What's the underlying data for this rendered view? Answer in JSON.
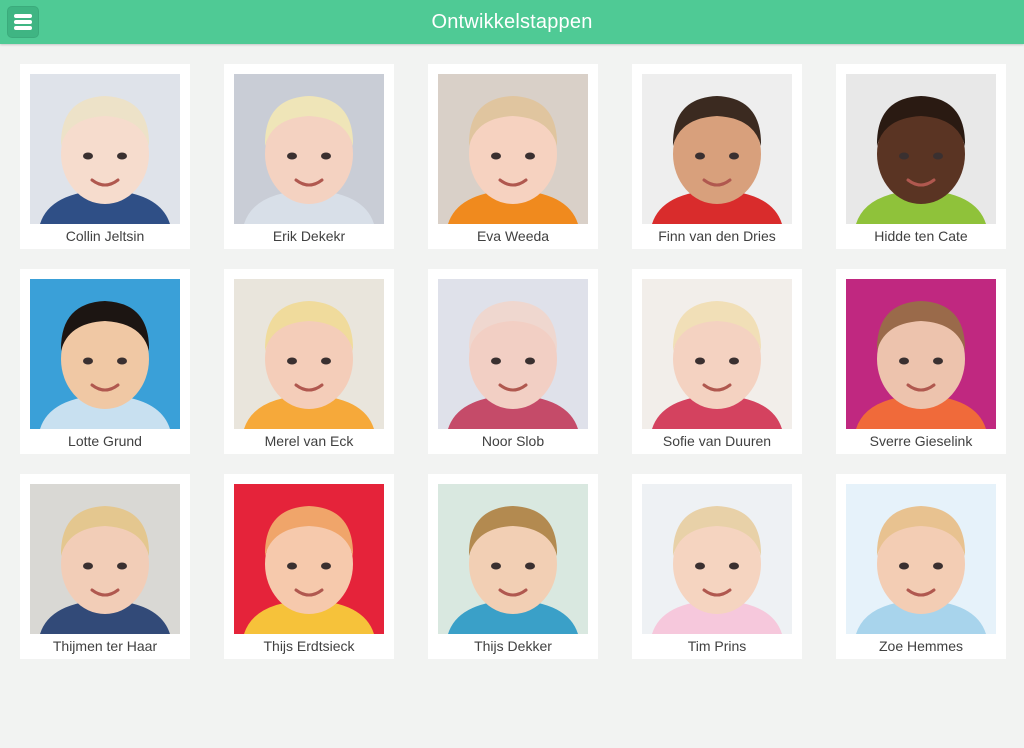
{
  "header": {
    "title": "Ontwikkelstappen",
    "menu_icon": "hamburger-menu-icon",
    "color": "#4fca95"
  },
  "children": [
    {
      "name": "Collin Jeltsin",
      "bg": "#dfe3ea",
      "skin": "#f6dccd",
      "hair": "#ede2c8",
      "shirt": "#2f4f86"
    },
    {
      "name": "Erik Dekekr",
      "bg": "#c9cdd6",
      "skin": "#f4d2c1",
      "hair": "#efe5b8",
      "shirt": "#d8dfe8"
    },
    {
      "name": "Eva Weeda",
      "bg": "#d9d0c8",
      "skin": "#f6d2c0",
      "hair": "#e0c59f",
      "shirt": "#f08a1e"
    },
    {
      "name": "Finn van den Dries",
      "bg": "#eeeeee",
      "skin": "#d8a07c",
      "hair": "#3b2a20",
      "shirt": "#d92c2c"
    },
    {
      "name": "Hidde ten Cate",
      "bg": "#e8e8e8",
      "skin": "#5a3423",
      "hair": "#2a1a12",
      "shirt": "#8fc23a"
    },
    {
      "name": "Lotte Grund",
      "bg": "#3aa0d8",
      "skin": "#f0c8a4",
      "hair": "#1c1512",
      "shirt": "#c8e0f0"
    },
    {
      "name": "Merel van Eck",
      "bg": "#e9e5dc",
      "skin": "#f4cdb9",
      "hair": "#f0db9c",
      "shirt": "#f6a93a"
    },
    {
      "name": "Noor Slob",
      "bg": "#dfe1ea",
      "skin": "#f2cfc4",
      "hair": "#efd7cf",
      "shirt": "#c54b69"
    },
    {
      "name": "Sofie van Duuren",
      "bg": "#f2eeea",
      "skin": "#f4d2c1",
      "hair": "#f1dfb7",
      "shirt": "#d4425f"
    },
    {
      "name": "Sverre Gieselink",
      "bg": "#c02880",
      "skin": "#edc3ad",
      "hair": "#9a6a4a",
      "shirt": "#f06a3a"
    },
    {
      "name": "Thijmen ter Haar",
      "bg": "#d9d8d4",
      "skin": "#f2cdb7",
      "hair": "#e4c78f",
      "shirt": "#324a78"
    },
    {
      "name": "Thijs Erdtsieck",
      "bg": "#e5233a",
      "skin": "#f6c9ac",
      "hair": "#f0a56a",
      "shirt": "#f6c23a"
    },
    {
      "name": "Thijs Dekker",
      "bg": "#d9e8e0",
      "skin": "#f2cfb4",
      "hair": "#b38a50",
      "shirt": "#3aa0c8"
    },
    {
      "name": "Tim Prins",
      "bg": "#eef1f4",
      "skin": "#f5d4c0",
      "hair": "#e8d1a8",
      "shirt": "#f6c8dc"
    },
    {
      "name": "Zoe Hemmes",
      "bg": "#e6f2fa",
      "skin": "#f3cdb4",
      "hair": "#e8c290",
      "shirt": "#a8d4ec"
    }
  ]
}
